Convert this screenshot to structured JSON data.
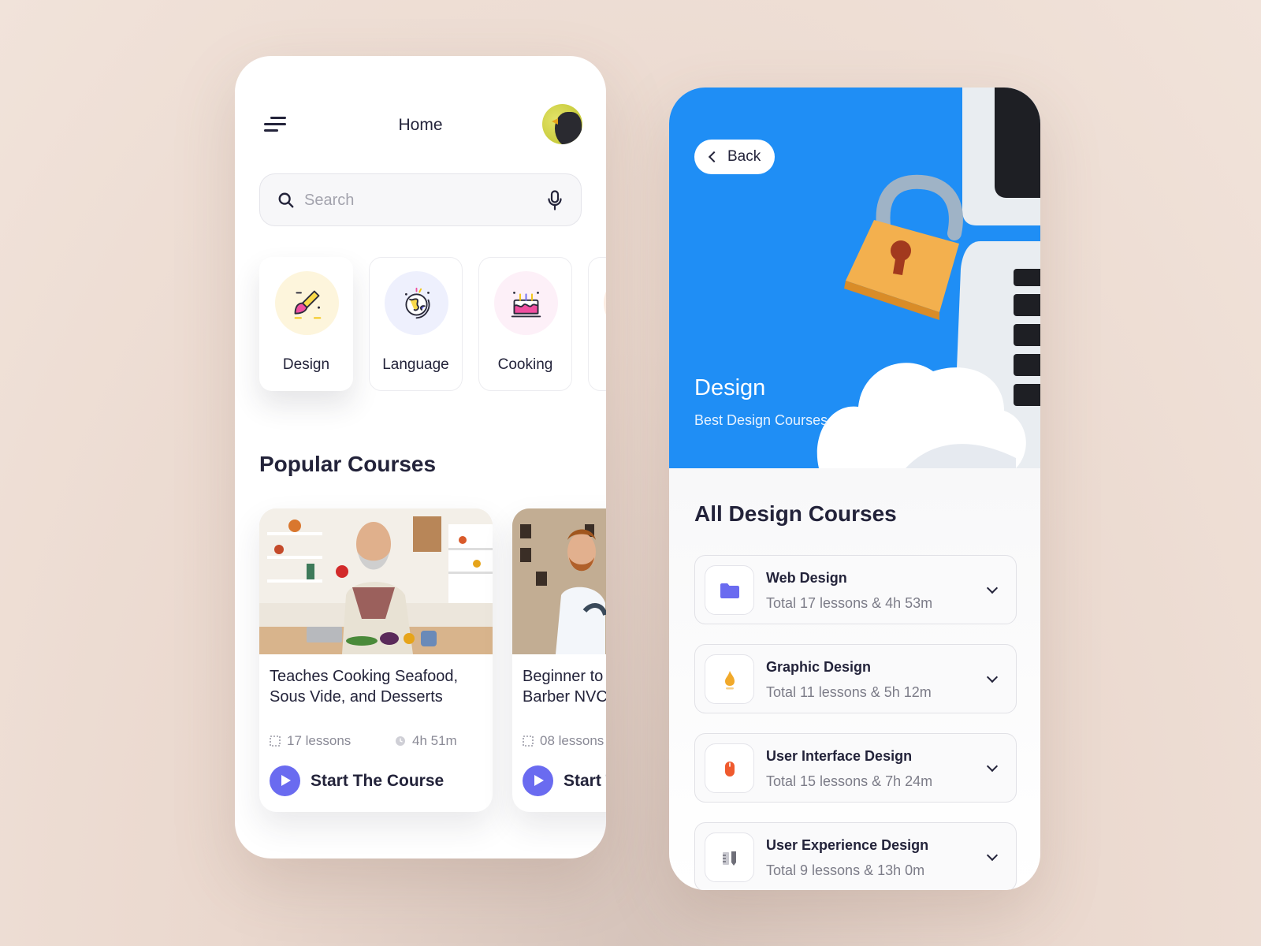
{
  "home": {
    "title": "Home",
    "search": {
      "placeholder": "Search"
    },
    "categories": [
      {
        "label": "Design",
        "icon": "brush-icon",
        "bg": "#fdf5dc"
      },
      {
        "label": "Language",
        "icon": "globe-icon",
        "bg": "#eef0fd"
      },
      {
        "label": "Cooking",
        "icon": "cake-icon",
        "bg": "#fdf0f8"
      }
    ],
    "popular_title": "Popular Courses",
    "courses": [
      {
        "title": "Teaches Cooking Seafood,\nSous Vide, and Desserts",
        "lessons": "17 lessons",
        "duration": "4h 51m",
        "cta": "Start The Course"
      },
      {
        "title": "Beginner to\nBarber NVC",
        "lessons": "08 lessons",
        "cta": "Start The Course"
      }
    ]
  },
  "detail": {
    "back_label": "Back",
    "hero_title": "Design",
    "hero_subtitle": "Best Design Courses",
    "list_title": "All Design Courses",
    "courses": [
      {
        "title": "Web Design",
        "subtitle": "Total 17 lessons & 4h 53m",
        "icon": "folder-icon",
        "color": "#6a6bf0"
      },
      {
        "title": "Graphic Design",
        "subtitle": "Total 11 lessons & 5h 12m",
        "icon": "flame-icon",
        "color": "#f1a92a"
      },
      {
        "title": "User Interface Design",
        "subtitle": "Total 15 lessons & 7h 24m",
        "icon": "mouse-icon",
        "color": "#ef5a2e"
      },
      {
        "title": "User Experience Design",
        "subtitle": "Total 9 lessons & 13h 0m",
        "icon": "tools-icon",
        "color": "#6e6e78"
      }
    ]
  },
  "colors": {
    "accent": "#6a6bf0",
    "hero_blue": "#1f8ef5",
    "text": "#23233a"
  }
}
